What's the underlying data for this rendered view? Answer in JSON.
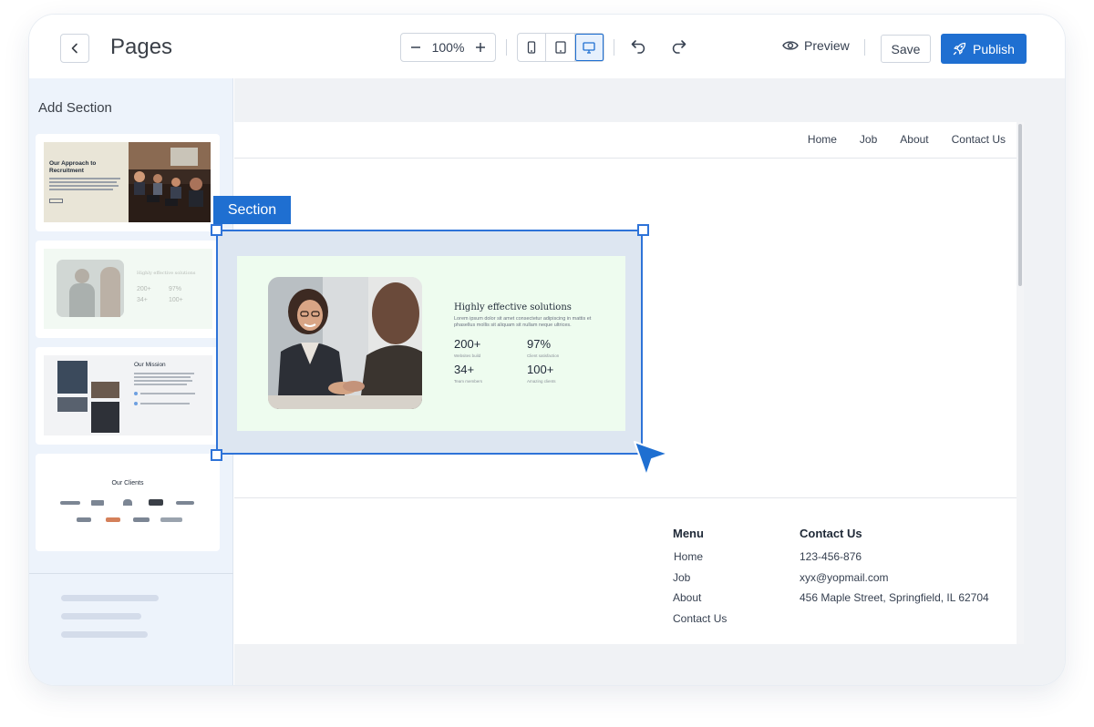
{
  "toolbar": {
    "title": "Pages",
    "zoom": "100%",
    "preview_label": "Preview",
    "save_label": "Save",
    "publish_label": "Publish",
    "accent_color": "#1f6fd1"
  },
  "sidebar": {
    "title": "Add Section",
    "thumbnails": [
      {
        "title": "Our Approach to Recruitment"
      },
      {
        "title": "Highly effective solutions",
        "stats": [
          "200+",
          "97%",
          "34+",
          "100+"
        ]
      },
      {
        "title": "Our Mission"
      },
      {
        "title": "Our Clients"
      }
    ]
  },
  "canvas": {
    "nav": [
      "Home",
      "Job",
      "About",
      "Contact Us"
    ],
    "section_tag": "Section",
    "section": {
      "title": "Highly effective solutions",
      "description": "Lorem ipsum dolor sit amet consectetur adipiscing in mattis et phasellus mollis sit aliquam sit nullam neque ultrices.",
      "stats": [
        {
          "value": "200+",
          "label": "Websites build"
        },
        {
          "value": "97%",
          "label": "Client satisfaction"
        },
        {
          "value": "34+",
          "label": "Team members"
        },
        {
          "value": "100+",
          "label": "Amazing clients"
        }
      ]
    },
    "footer": {
      "menu_heading": "Menu",
      "menu_items": [
        "Home",
        "Job",
        "About",
        "Contact Us"
      ],
      "contact_heading": "Contact Us",
      "contact_items": [
        "123-456-876",
        "xyx@yopmail.com",
        "456 Maple Street, Springfield, IL 62704"
      ]
    }
  }
}
